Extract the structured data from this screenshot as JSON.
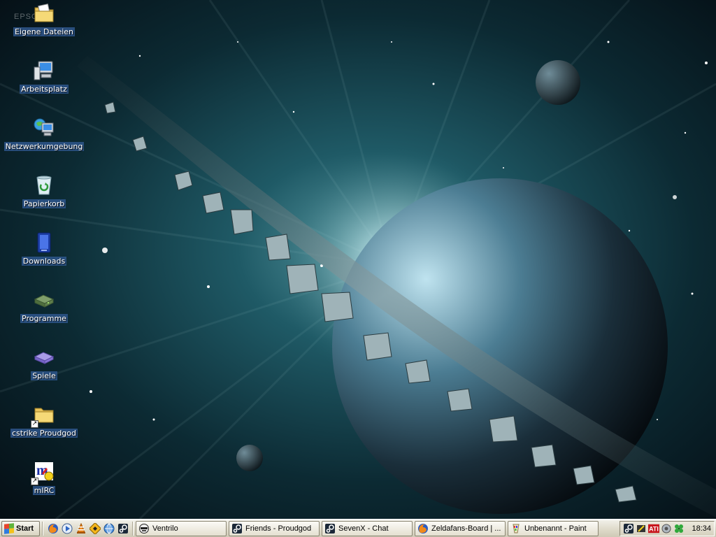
{
  "desktop": {
    "watermark": "EPSON",
    "icons": [
      {
        "label": "Eigene Dateien",
        "icon": "folder-documents-icon"
      },
      {
        "label": "Arbeitsplatz",
        "icon": "computer-icon"
      },
      {
        "label": "Netzwerkumgebung",
        "icon": "network-icon"
      },
      {
        "label": "Papierkorb",
        "icon": "recycle-bin-icon"
      },
      {
        "label": "Downloads",
        "icon": "downloads-icon"
      },
      {
        "label": "Programme",
        "icon": "drive-icon"
      },
      {
        "label": "Spiele",
        "icon": "gamepad-icon"
      },
      {
        "label": "cstrike Proudgod",
        "icon": "folder-shortcut-icon"
      },
      {
        "label": "mIRC",
        "icon": "mirc-icon"
      }
    ]
  },
  "taskbar": {
    "start_label": "Start",
    "quick_launch": [
      "firefox-icon",
      "media-player-icon",
      "vlc-icon",
      "winamp-icon",
      "browser-icon",
      "steam-icon"
    ],
    "tasks": [
      {
        "label": "Ventrilo",
        "icon": "ventrilo-icon"
      },
      {
        "label": "Friends - Proudgod",
        "icon": "steam-icon"
      },
      {
        "label": "SevenX - Chat",
        "icon": "steam-icon"
      },
      {
        "label": "Zeldafans-Board | ...",
        "icon": "firefox-icon"
      },
      {
        "label": "Unbenannt - Paint",
        "icon": "paint-icon"
      }
    ],
    "tray": {
      "icons": [
        "steam-icon",
        "pen-tablet-icon",
        "ati-icon",
        "sound-icon",
        "clover-icon"
      ],
      "ati_label": "ATI",
      "clock": "18:34"
    }
  },
  "colors": {
    "label_bg": "#2e568c",
    "taskbar_bg": "#ddd9c8",
    "space_dark": "#06141c",
    "space_teal": "#1f5a66"
  }
}
